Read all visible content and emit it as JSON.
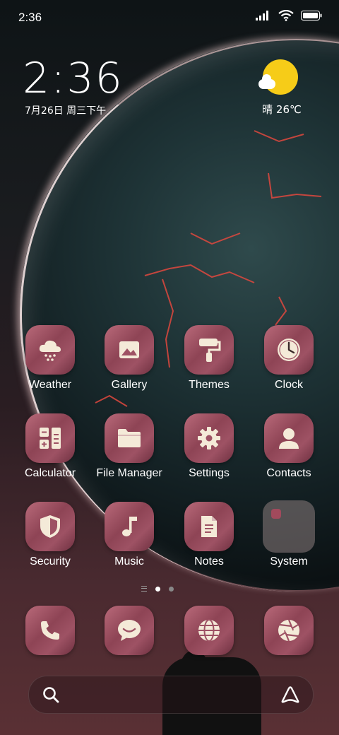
{
  "status_bar": {
    "time": "2:36"
  },
  "widget": {
    "clock": "2:36",
    "date": "7月26日 周三下午",
    "weather": "晴 26℃"
  },
  "apps": [
    {
      "label": "Weather",
      "icon": "weather-snow-cloud-icon"
    },
    {
      "label": "Gallery",
      "icon": "gallery-image-icon"
    },
    {
      "label": "Themes",
      "icon": "paint-roller-icon"
    },
    {
      "label": "Clock",
      "icon": "clock-icon"
    },
    {
      "label": "Calculator",
      "icon": "calculator-icon"
    },
    {
      "label": "File Manager",
      "icon": "folder-icon"
    },
    {
      "label": "Settings",
      "icon": "gear-icon"
    },
    {
      "label": "Contacts",
      "icon": "person-icon"
    },
    {
      "label": "Security",
      "icon": "shield-icon"
    },
    {
      "label": "Music",
      "icon": "music-note-icon"
    },
    {
      "label": "Notes",
      "icon": "document-icon"
    },
    {
      "label": "System",
      "icon": "folder-group-icon"
    }
  ],
  "dock": [
    {
      "icon": "phone-icon"
    },
    {
      "icon": "message-bubble-icon"
    },
    {
      "icon": "globe-icon"
    },
    {
      "icon": "camera-aperture-icon"
    }
  ],
  "page_indicator": {
    "pages": 2,
    "current": 1
  },
  "colors": {
    "tile": "#9e5264",
    "glyph": "#f4ead8",
    "sun": "#f6cc18"
  }
}
